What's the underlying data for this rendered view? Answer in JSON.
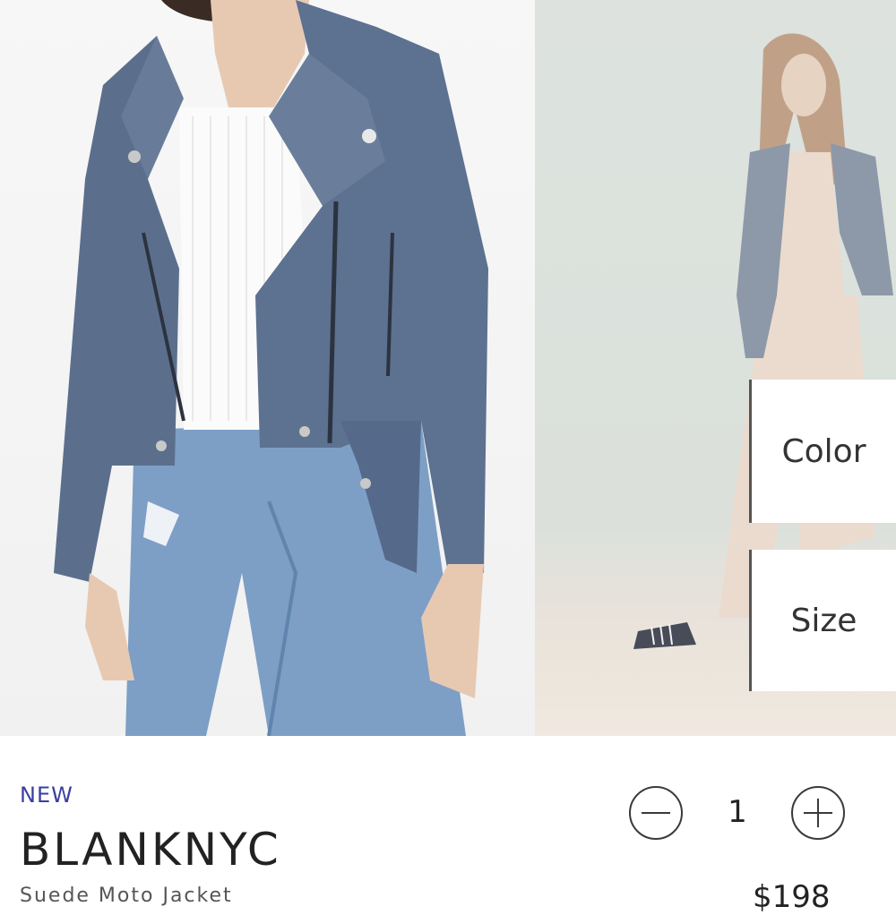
{
  "product": {
    "badge": "NEW",
    "brand": "BLANKNYC",
    "subtitle": "Suede Moto Jacket",
    "price": "$198"
  },
  "options": {
    "color_label": "Color",
    "size_label": "Size"
  },
  "quantity": {
    "value": "1",
    "decrement_icon": "minus-circle-icon",
    "increment_icon": "plus-circle-icon"
  },
  "colors": {
    "jacket": "#5b6f8d",
    "accent": "#3a3fa0",
    "panel_bg": "#d8ded8"
  }
}
